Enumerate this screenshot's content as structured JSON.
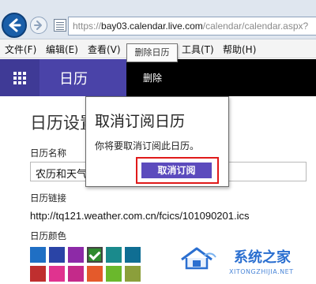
{
  "browser": {
    "url_prefix": "https://",
    "url_domain": "bay03.calendar.live.com",
    "url_path": "/calendar/calendar.aspx?",
    "menu": [
      "文件(F)",
      "编辑(E)",
      "查看(V)",
      "工具(T)",
      "帮助(H)"
    ]
  },
  "tooltip": "删除日历",
  "app": {
    "title": "日历",
    "delete_action": "删除"
  },
  "settings": {
    "page_title": "日历设置",
    "name_label": "日历名称",
    "name_value": "农历和天气",
    "link_label": "日历链接",
    "link_value": "http://tq121.weather.com.cn/fcics/101090201.ics",
    "color_label": "日历颜色",
    "colors": [
      "#1f6fc4",
      "#2a44a6",
      "#8d2aa7",
      "#2e8a2e",
      "#1a8a8c",
      "#0f6e93",
      "#bf2f2f",
      "#e0338f",
      "#c42a8a",
      "#e45a2b",
      "#6ab82c",
      "#8b9f3b"
    ],
    "selected_color_index": 3
  },
  "dialog": {
    "title": "取消订阅日历",
    "message": "你将要取消订阅此日历。",
    "confirm_button": "取消订阅"
  },
  "watermark": {
    "title": "系统之家",
    "url": "XITONGZHIJIA.NET"
  }
}
